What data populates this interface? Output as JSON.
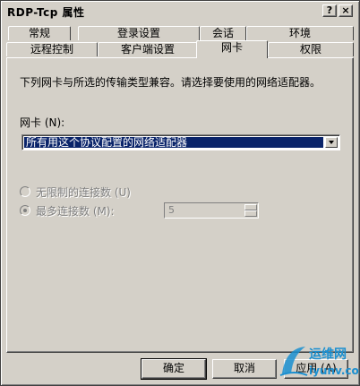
{
  "window": {
    "title": "RDP-Tcp 属性"
  },
  "titlebar_buttons": {
    "help": "?",
    "close": "×"
  },
  "tabs_row1": [
    "常规",
    "登录设置",
    "会话",
    "环境"
  ],
  "tabs_row2": [
    "远程控制",
    "客户端设置",
    "网卡",
    "权限"
  ],
  "active_tab": "网卡",
  "panel": {
    "description": "下列网卡与所选的传输类型兼容。请选择要使用的网络适配器。",
    "adapter_label": "网卡 (N):",
    "adapter_selected": "所有用这个协议配置的网络适配器",
    "radio_unlimited": "无限制的连接数 (U)",
    "radio_max": "最多连接数 (M):",
    "max_value": "5"
  },
  "buttons": {
    "ok": "确定",
    "cancel": "取消",
    "apply": "应用 (A)"
  },
  "watermark": {
    "cn": "运维网",
    "en": "iyunv.com"
  },
  "colors": {
    "face": "#d4d0c8",
    "selection": "#0a246a",
    "watermark": "#1a8fd0"
  },
  "icons": {
    "help": "help-icon",
    "close": "close-icon",
    "dropdown": "chevron-down-icon"
  }
}
